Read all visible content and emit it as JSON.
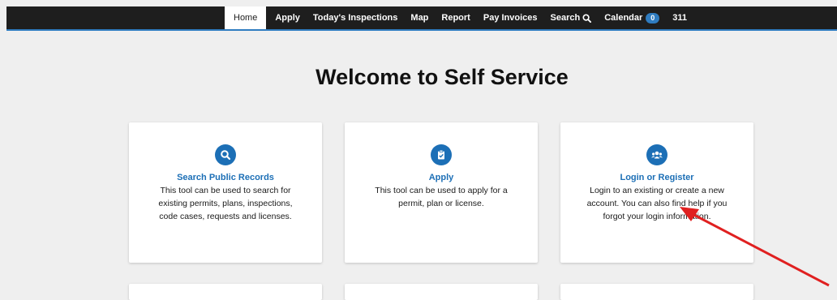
{
  "nav": {
    "items": [
      {
        "label": "Home",
        "active": true
      },
      {
        "label": "Apply"
      },
      {
        "label": "Today's Inspections"
      },
      {
        "label": "Map"
      },
      {
        "label": "Report"
      },
      {
        "label": "Pay Invoices"
      },
      {
        "label": "Search",
        "icon": "search-icon"
      },
      {
        "label": "Calendar",
        "badge": "0"
      },
      {
        "label": "311"
      }
    ]
  },
  "page": {
    "title": "Welcome to Self Service"
  },
  "cards": [
    {
      "icon": "search-icon",
      "title": "Search Public Records",
      "description": "This tool can be used to search for existing permits, plans, inspections, code cases, requests and licenses."
    },
    {
      "icon": "clipboard-check-icon",
      "title": "Apply",
      "description": "This tool can be used to apply for a permit, plan or license."
    },
    {
      "icon": "users-icon",
      "title": "Login or Register",
      "description": "Login to an existing or create a new account. You can also find help if you forgot your login information."
    }
  ],
  "colors": {
    "navbar": "#1e1e1e",
    "accent": "#1c6fb6",
    "background": "#efefef",
    "annotation_arrow": "#e02020"
  }
}
